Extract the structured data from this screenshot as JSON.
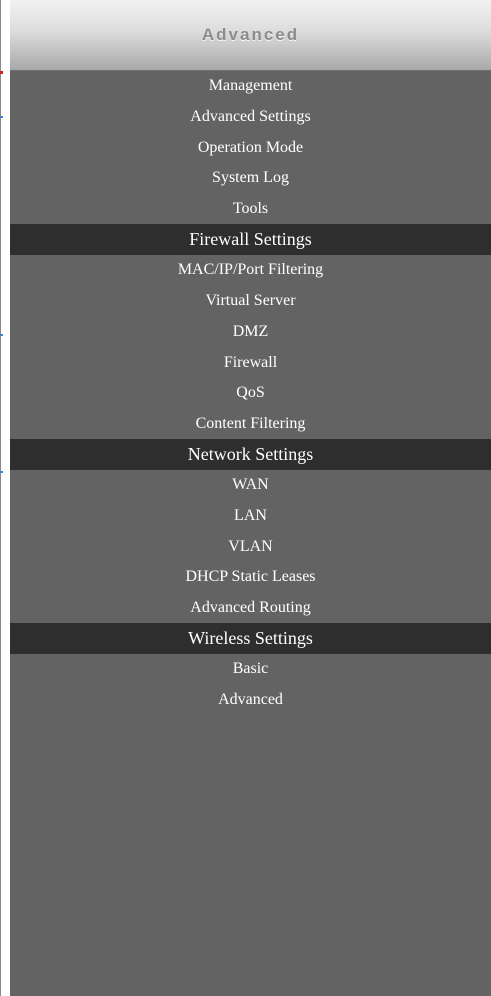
{
  "menu": {
    "header": "Advanced",
    "groups": [
      {
        "title": "",
        "items": [
          "Management",
          "Advanced Settings",
          "Operation Mode",
          "System Log",
          "Tools"
        ]
      },
      {
        "title": "Firewall Settings",
        "items": [
          "MAC/IP/Port Filtering",
          "Virtual Server",
          "DMZ",
          "Firewall",
          "QoS",
          "Content Filtering"
        ]
      },
      {
        "title": "Network Settings",
        "items": [
          "WAN",
          "LAN",
          "VLAN",
          "DHCP Static Leases",
          "Advanced Routing"
        ]
      },
      {
        "title": "Wireless Settings",
        "items": [
          "Basic",
          "Advanced"
        ]
      }
    ]
  },
  "colors": {
    "menu_background": "#636363",
    "section_background": "#2e2e2e",
    "item_text": "#ffffff",
    "header_text": "#8c8c8c"
  }
}
